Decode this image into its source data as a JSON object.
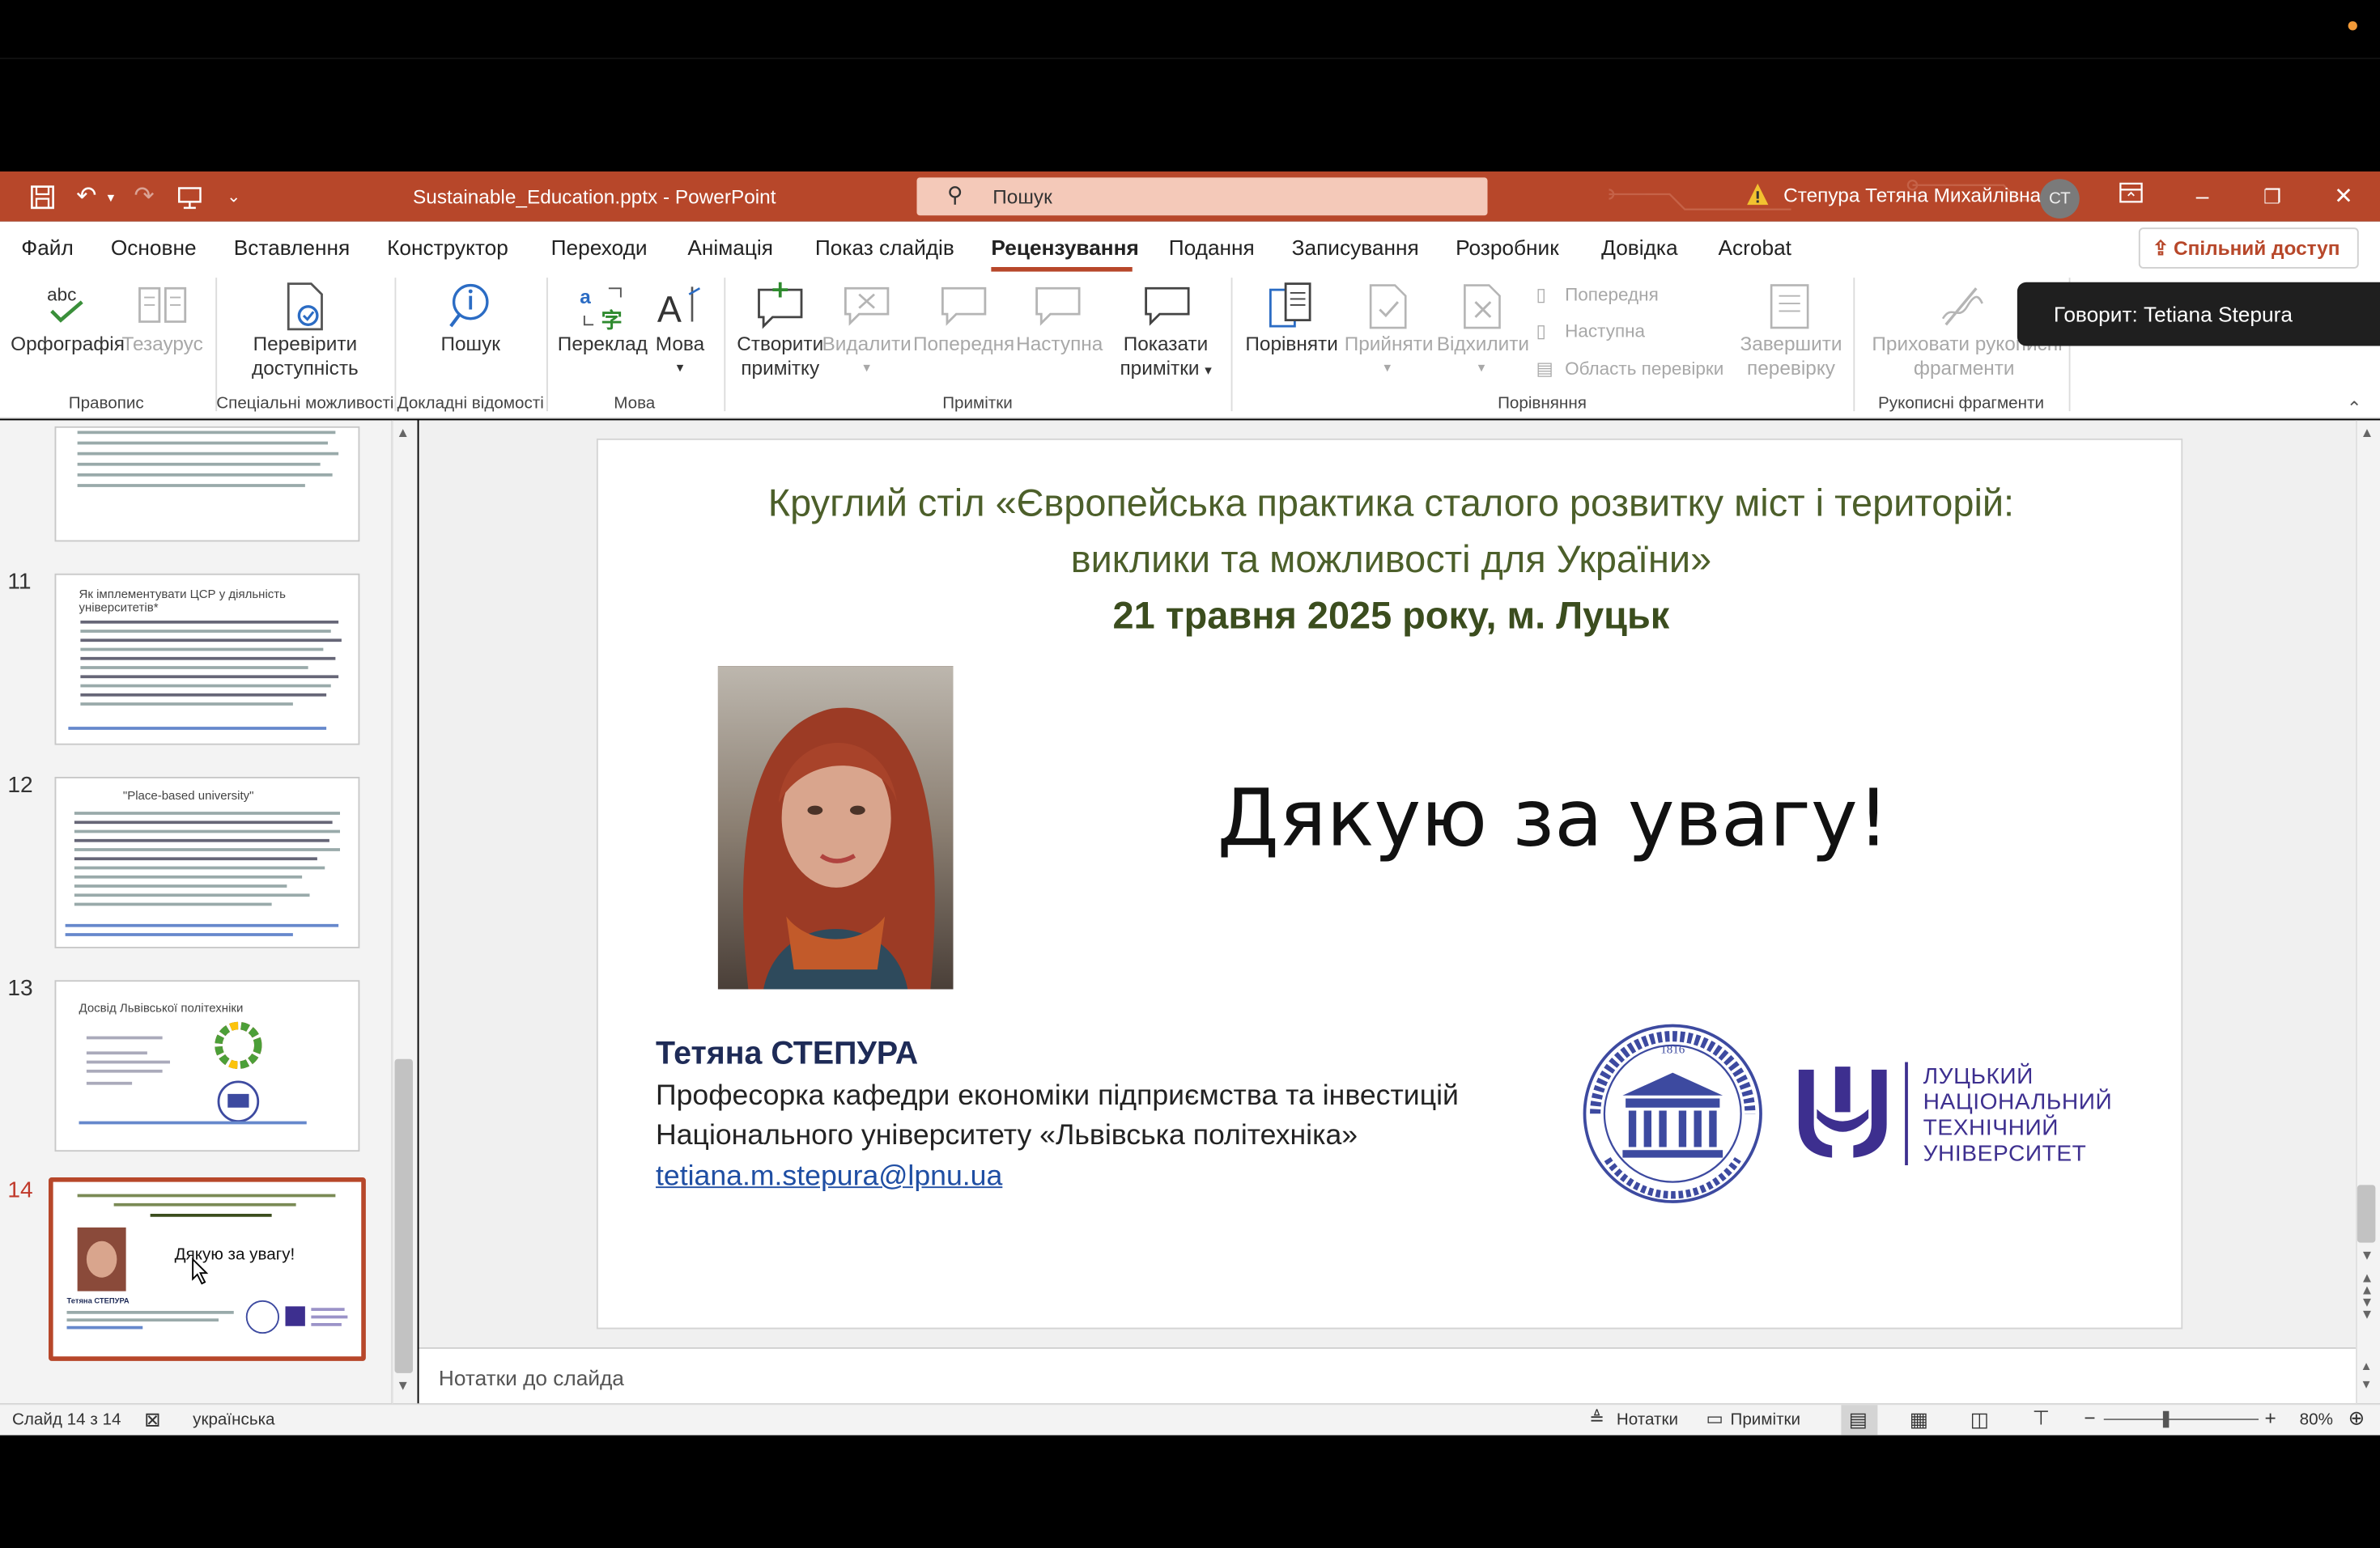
{
  "window": {
    "doc_title": "Sustainable_Education.pptx  -  PowerPoint",
    "search_placeholder": "Пошук",
    "user_name": "Степура Тетяна Михайлівна",
    "user_initials": "СТ"
  },
  "menu": {
    "items": [
      "Файл",
      "Основне",
      "Вставлення",
      "Конструктор",
      "Переходи",
      "Анімація",
      "Показ слайдів",
      "Рецензування",
      "Подання",
      "Записування",
      "Розробник",
      "Довідка",
      "Acrobat"
    ],
    "share_label": "Спільний доступ"
  },
  "ribbon": {
    "spelling": "Орфографія",
    "thesaurus": "Тезаурус",
    "check_accessibility_1": "Перевірити",
    "check_accessibility_2": "доступність",
    "search": "Пошук",
    "translate": "Переклад",
    "language": "Мова",
    "new_comment_1": "Створити",
    "new_comment_2": "примітку",
    "delete": "Видалити",
    "previous": "Попередня",
    "next": "Наступна",
    "show_comments_1": "Показати",
    "show_comments_2": "примітки",
    "compare": "Порівняти",
    "accept": "Прийняти",
    "reject": "Відхилити",
    "cmp_prev": "Попередня",
    "cmp_next": "Наступна",
    "review_pane": "Область перевірки",
    "end_review_1": "Завершити",
    "end_review_2": "перевірку",
    "hide_ink_1": "Приховати рукописні",
    "hide_ink_2": "фрагменти",
    "groups": {
      "proofing": "Правопис",
      "accessibility": "Спеціальні можливості",
      "insights": "Докладні відомості",
      "language": "Мова",
      "comments": "Примітки",
      "compare": "Порівняння",
      "ink": "Рукописні фрагменти"
    }
  },
  "tooltip": "Говорит: Tetiana Stepura",
  "thumbnails": {
    "n11": "11",
    "n12": "12",
    "n13": "13",
    "n14": "14",
    "t11_title": "Як імплементувати ЦСР у діяльність університетів*",
    "t12_title": "\"Place-based university\"",
    "t13_title": "Досвід Львівської політехніки",
    "t14_thanks": "Дякую за увагу!",
    "t14_name": "Тетяна СТЕПУРА"
  },
  "slide": {
    "title_line1": "Круглий стіл «Європейська практика сталого розвитку міст і територій:",
    "title_line2": "виклики та можливості для України»",
    "date_line": "21 травня 2025 року, м. Луцьк",
    "thanks": "Дякую за увагу!",
    "name": "Тетяна СТЕПУРА",
    "aff_line1": "Професорка кафедри економіки підприємства та інвестицій",
    "aff_line2": "Національного університету «Львівська політехніка»",
    "email": "tetiana.m.stepura@lpnu.ua",
    "lutsk_line1": "ЛУЦЬКИЙ",
    "lutsk_line2": "НАЦІОНАЛЬНИЙ",
    "lutsk_line3": "ТЕХНІЧНИЙ",
    "lutsk_line4": "УНІВЕРСИТЕТ",
    "lp_seal_text": "НАЦІОНАЛЬНИЙ УНІВЕРСИТЕТ ЛЬВІВСЬКА ПОЛІТЕХНІКА 1816 LITTERIS ET ARTIBUS"
  },
  "notes_placeholder": "Нотатки до слайда",
  "status": {
    "slide_count": "Слайд 14 з 14",
    "language": "українська",
    "notes": "Нотатки",
    "comments": "Примітки",
    "zoom": "80%"
  },
  "colors": {
    "accent": "#b7472a",
    "slide_title": "#4c5f2a",
    "name": "#1e2b57",
    "lutsk": "#3d2f8f"
  }
}
